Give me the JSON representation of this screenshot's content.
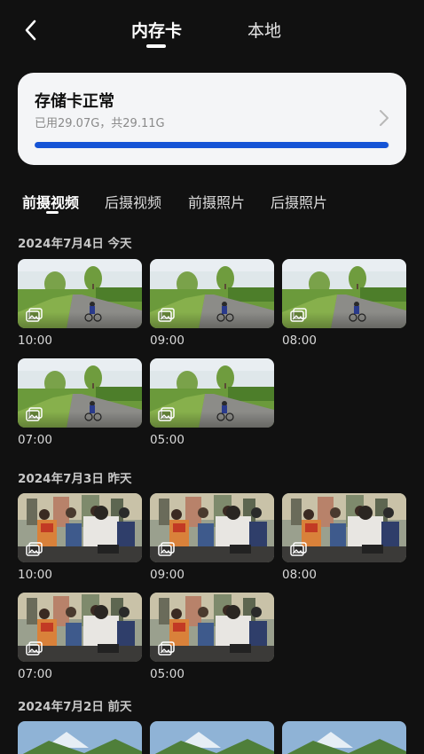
{
  "header": {
    "back_icon": "chevron-left-icon",
    "tabs": [
      {
        "label": "内存卡",
        "active": true
      },
      {
        "label": "本地",
        "active": false
      }
    ]
  },
  "storage": {
    "title": "存储卡正常",
    "usage_text": "已用29.07G，共29.11G",
    "used_fraction": 0.9986,
    "chevron_icon": "chevron-right-icon",
    "bar_color": "#1554d6"
  },
  "categories": [
    {
      "label": "前摄视频",
      "active": true
    },
    {
      "label": "后摄视频",
      "active": false
    },
    {
      "label": "前摄照片",
      "active": false
    },
    {
      "label": "后摄照片",
      "active": false
    }
  ],
  "groups": [
    {
      "date": "2024年7月4日  今天",
      "items": [
        {
          "time": "10:00",
          "scene": "cyclist"
        },
        {
          "time": "09:00",
          "scene": "cyclist"
        },
        {
          "time": "08:00",
          "scene": "cyclist"
        },
        {
          "time": "07:00",
          "scene": "cyclist"
        },
        {
          "time": "05:00",
          "scene": "cyclist"
        }
      ]
    },
    {
      "date": "2024年7月3日  昨天",
      "items": [
        {
          "time": "10:00",
          "scene": "traffic"
        },
        {
          "time": "09:00",
          "scene": "traffic"
        },
        {
          "time": "08:00",
          "scene": "traffic"
        },
        {
          "time": "07:00",
          "scene": "traffic"
        },
        {
          "time": "05:00",
          "scene": "traffic"
        }
      ]
    },
    {
      "date": "2024年7月2日  前天",
      "items": [
        {
          "time": "",
          "scene": "mountain"
        },
        {
          "time": "",
          "scene": "mountain"
        },
        {
          "time": "",
          "scene": "mountain"
        }
      ]
    }
  ],
  "thumb_icon": "gallery-icon"
}
